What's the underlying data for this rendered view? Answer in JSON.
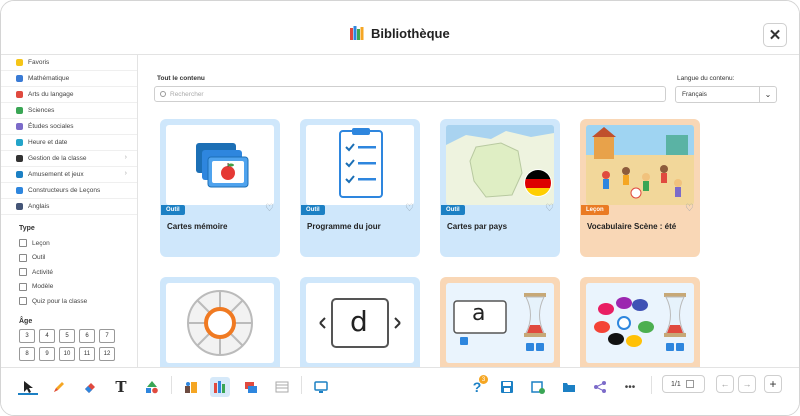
{
  "header": {
    "title": "Bibliothèque",
    "close": "✕"
  },
  "sidebar": {
    "categories": [
      {
        "label": "Favoris",
        "color": "#f5c518",
        "chevron": false
      },
      {
        "label": "Mathématique",
        "color": "#3a7bd5",
        "chevron": false
      },
      {
        "label": "Arts du langage",
        "color": "#e04a3f",
        "chevron": false
      },
      {
        "label": "Sciences",
        "color": "#3aa655",
        "chevron": false
      },
      {
        "label": "Études sociales",
        "color": "#7c6bc9",
        "chevron": false
      },
      {
        "label": "Heure et date",
        "color": "#23a4c9",
        "chevron": false
      },
      {
        "label": "Gestion de la classe",
        "color": "#333333",
        "chevron": true
      },
      {
        "label": "Amusement et jeux",
        "color": "#1c80c4",
        "chevron": true
      },
      {
        "label": "Constructeurs de Leçons",
        "color": "#2e86de",
        "chevron": false
      },
      {
        "label": "Anglais",
        "color": "#445577",
        "chevron": false
      }
    ],
    "type_title": "Type",
    "types": [
      "Leçon",
      "Outil",
      "Activité",
      "Modèle",
      "Quiz pour la classe"
    ],
    "age_title": "Âge",
    "ages": [
      "3",
      "4",
      "5",
      "6",
      "7",
      "8",
      "9",
      "10",
      "11",
      "12"
    ]
  },
  "content": {
    "all_label": "Tout le contenu",
    "search_placeholder": "Rechercher",
    "lang_label": "Langue du contenu:",
    "lang_value": "Français",
    "cards": [
      {
        "title": "Cartes mémoire",
        "badge": "Outil",
        "kind": "tool"
      },
      {
        "title": "Programme du jour",
        "badge": "Outil",
        "kind": "tool"
      },
      {
        "title": "Cartes par pays",
        "badge": "Outil",
        "kind": "tool"
      },
      {
        "title": "Vocabulaire Scène : été",
        "badge": "Leçon",
        "kind": "lesson"
      },
      {
        "title": "",
        "badge": "",
        "kind": "tool"
      },
      {
        "title": "",
        "badge": "",
        "kind": "tool"
      },
      {
        "title": "",
        "badge": "",
        "kind": "lesson"
      },
      {
        "title": "",
        "badge": "",
        "kind": "lesson"
      }
    ],
    "thumb_letters": {
      "d_card": "d",
      "a_card": "a"
    }
  },
  "toolbar": {
    "page_indicator": "1/1",
    "help_badge": "3",
    "text_tool": "T",
    "more": "•••",
    "prev": "←",
    "next": "→",
    "add": "+"
  }
}
